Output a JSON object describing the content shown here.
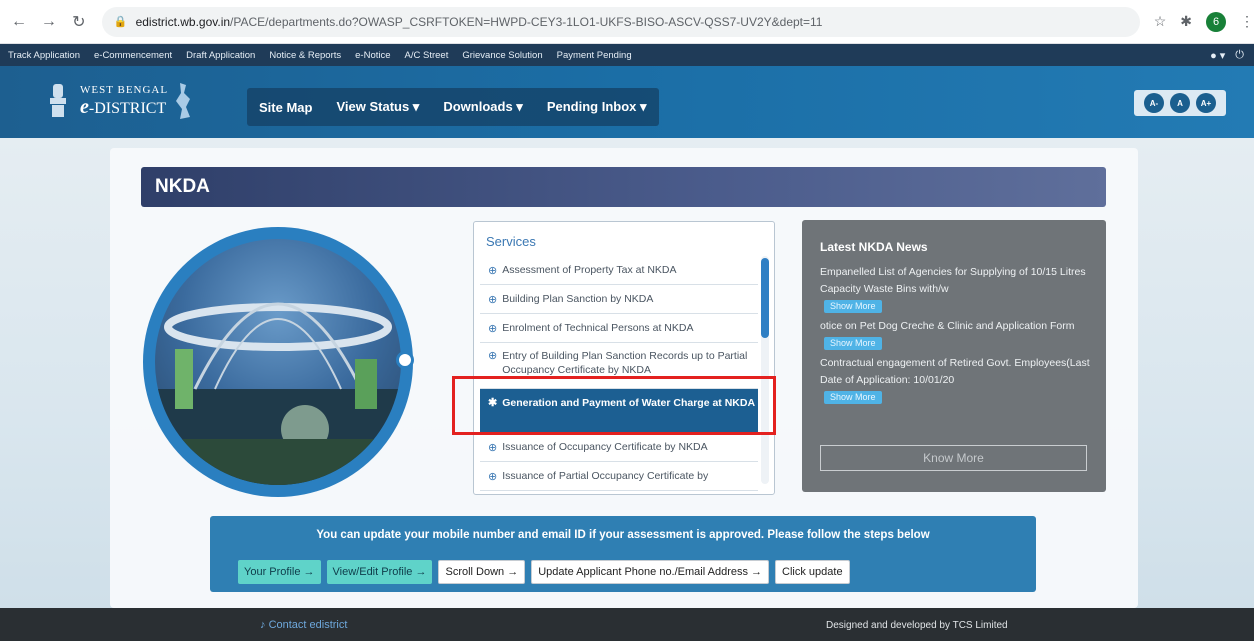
{
  "browser": {
    "url_host": "edistrict.wb.gov.in",
    "url_path": "/PACE/departments.do?OWASP_CSRFTOKEN=HWPD-CEY3-1LO1-UKFS-BISO-ASCV-QSS7-UV2Y&dept=11",
    "profile_initial": "6"
  },
  "util_bar": {
    "links": [
      "Track Application",
      "e-Commencement",
      "Draft Application",
      "Notice & Reports",
      "e-Notice",
      "A/C Street",
      "Grievance Solution",
      "Payment Pending"
    ]
  },
  "header": {
    "logo_small": "WEST BENGAL",
    "logo_e": "e",
    "logo_big": "-DISTRICT",
    "nav": [
      "Site Map",
      "View Status ▾",
      "Downloads ▾",
      "Pending Inbox ▾"
    ],
    "font_buttons": [
      "A-",
      "A",
      "A+"
    ]
  },
  "page": {
    "title": "NKDA",
    "services_title": "Services",
    "services": [
      "Assessment of Property Tax at NKDA",
      "Building Plan Sanction by NKDA",
      "Enrolment of Technical Persons at NKDA",
      "Entry of Building Plan Sanction Records up to Partial Occupancy Certificate by NKDA",
      "Generation and Payment of Water Charge at NKDA",
      "Issuance of Occupancy Certificate by NKDA",
      "Issuance of Partial Occupancy Certificate by"
    ],
    "selected_service_index": 4
  },
  "news": {
    "title": "Latest NKDA News",
    "items": [
      "Empanelled List of Agencies for Supplying of 10/15 Litres Capacity Waste Bins with/w",
      "otice on Pet Dog Creche & Clinic and Application Form",
      "Contractual engagement of Retired Govt. Employees(Last Date of Application: 10/01/20"
    ],
    "show_more": "Show More",
    "know_more": "Know More"
  },
  "update": {
    "text": "You can update your mobile number and email ID if your assessment is approved. Please follow the steps below",
    "buttons": [
      "Your Profile →",
      "View/Edit Profile →",
      "Scroll Down →",
      "Update Applicant Phone no./Email Address →",
      "Click update"
    ]
  },
  "footer": {
    "left": "Contact edistrict",
    "right": "Designed and developed by TCS Limited"
  },
  "colors": {
    "header_blue": "#1b6ea6",
    "title_bar": "#3c4d7c",
    "selected_service": "#1c5f92",
    "highlight_red": "#e3211f",
    "news_bg": "#6f7478",
    "update_band": "#2f7fb3"
  }
}
